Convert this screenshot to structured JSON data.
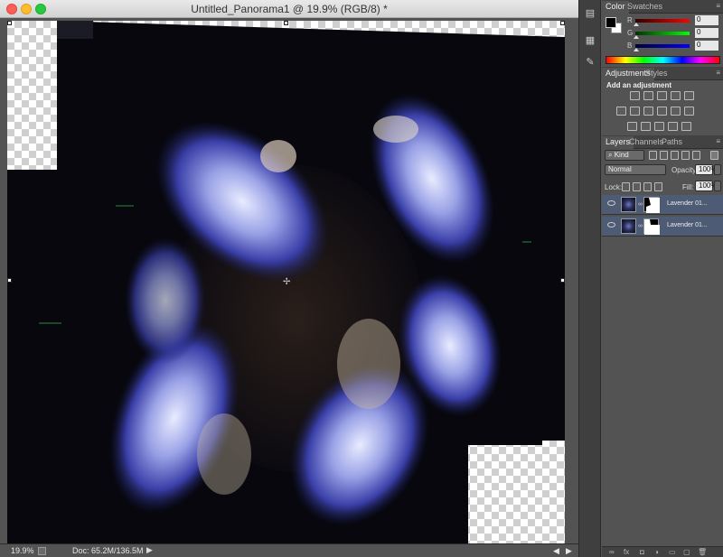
{
  "window": {
    "title": "Untitled_Panorama1 @ 19.9% (RGB/8) *"
  },
  "status": {
    "zoom": "19.9%",
    "doc_size": "Doc: 65.2M/136.5M",
    "arrow": "▶"
  },
  "color_panel": {
    "tabs": [
      "Color",
      "Swatches"
    ],
    "channels": [
      {
        "label": "R",
        "value": "0",
        "color": "#d03030"
      },
      {
        "label": "G",
        "value": "0",
        "color": "#30b030"
      },
      {
        "label": "B",
        "value": "0",
        "color": "#3040d0"
      }
    ]
  },
  "adjustments_panel": {
    "tabs": [
      "Adjustments",
      "Styles"
    ],
    "title": "Add an adjustment"
  },
  "layers_panel": {
    "tabs": [
      "Layers",
      "Channels",
      "Paths"
    ],
    "filter_kind": "Kind",
    "blend_mode": "Normal",
    "opacity_label": "Opacity:",
    "opacity_value": "100%",
    "lock_label": "Lock:",
    "fill_label": "Fill:",
    "fill_value": "100%",
    "layers": [
      {
        "name": "Lavender 01..."
      },
      {
        "name": "Lavender 01..."
      }
    ]
  },
  "icons": [
    "close-icon",
    "minimize-icon",
    "maximize-icon",
    "eye-icon",
    "link-icon",
    "lock-icon",
    "panel-menu-icon"
  ]
}
